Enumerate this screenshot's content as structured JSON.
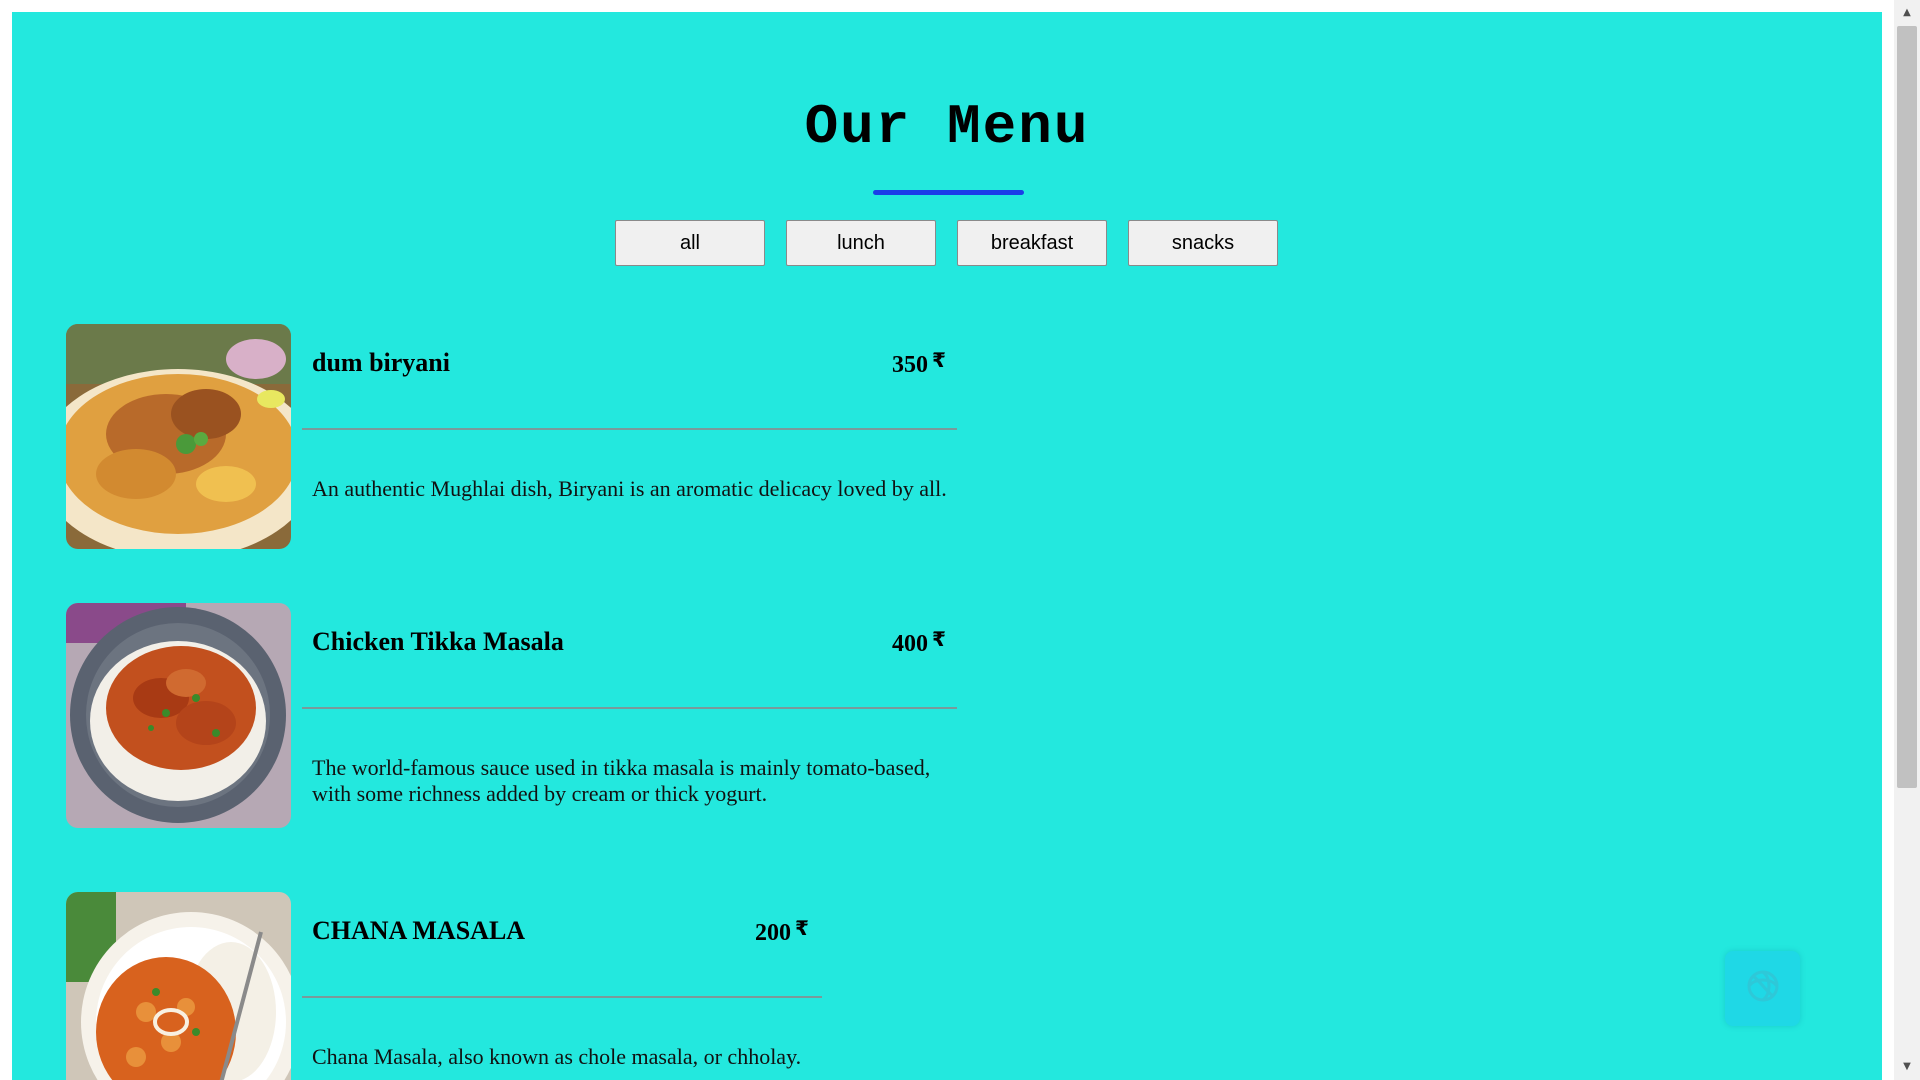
{
  "header": {
    "title": "Our Menu"
  },
  "filters": [
    "all",
    "lunch",
    "breakfast",
    "snacks"
  ],
  "menu_items": [
    {
      "name": "dum biryani",
      "price": "350",
      "currency": "₹",
      "description": "An authentic Mughlai dish, Biryani is an aromatic delicacy loved by all."
    },
    {
      "name": "Chicken Tikka Masala",
      "price": "400",
      "currency": "₹",
      "description": "The world-famous sauce used in tikka masala is mainly tomato-based, with some richness added by cream or thick yogurt."
    },
    {
      "name": "CHANA MASALA",
      "price": "200",
      "currency": "₹",
      "description": "Chana Masala, also known as chole masala, or chholay."
    }
  ],
  "colors": {
    "background": "#23e8de",
    "accent_underline": "#1a3ee8",
    "chat_widget": "#1fd8e6"
  },
  "icons": {
    "chat_widget": "chat-assistant-icon",
    "scroll_up": "scroll-up-arrow-icon",
    "scroll_down": "scroll-down-arrow-icon"
  }
}
